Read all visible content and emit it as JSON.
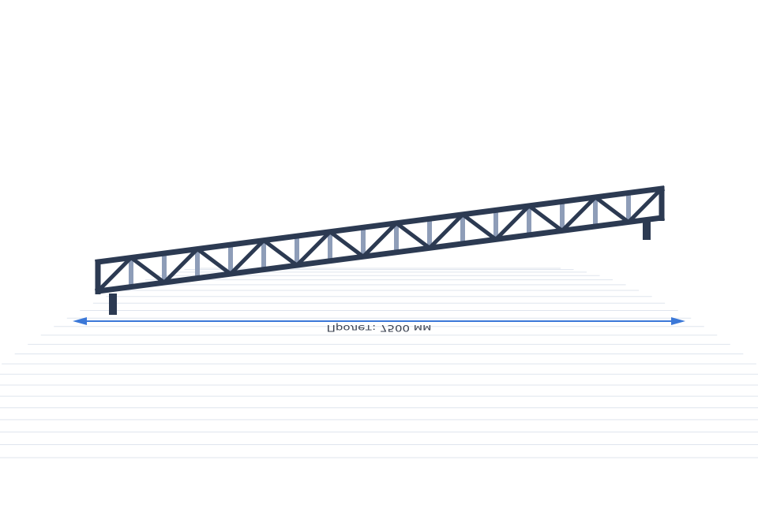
{
  "scene": {
    "span_label": "Пролет: 7500 мм",
    "colors": {
      "background": "#ffffff",
      "chord": "#2c3a52",
      "web": "#2c3a52",
      "vertical": "#8e9db8",
      "support": "#2c3a52",
      "grid": "#dfe5ee",
      "dimension": "#3b78d8"
    }
  }
}
